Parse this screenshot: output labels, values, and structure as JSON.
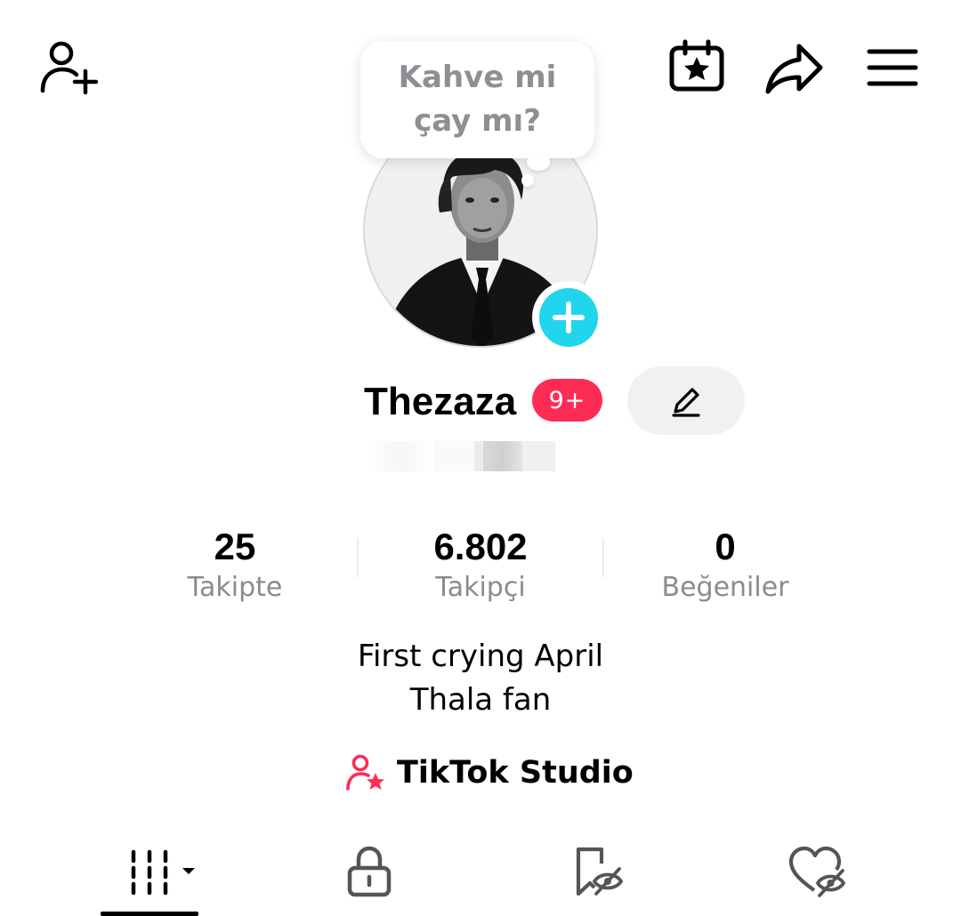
{
  "header": {
    "add_friend_icon": "person-plus-icon",
    "calendar_icon": "calendar-star-icon",
    "share_icon": "share-arrow-icon",
    "menu_icon": "hamburger-menu-icon"
  },
  "note": {
    "text": "Kahve mi\nçay mı?"
  },
  "profile": {
    "username": "Thezaza",
    "notification_badge": "9+",
    "edit_icon": "pencil-icon",
    "avatar_add_icon": "plus-icon"
  },
  "stats": [
    {
      "value": "25",
      "label": "Takipte"
    },
    {
      "value": "6.802",
      "label": "Takipçi"
    },
    {
      "value": "0",
      "label": "Beğeniler"
    }
  ],
  "bio": {
    "line1": "First crying April",
    "line2": "Thala fan"
  },
  "studio": {
    "label": "TikTok Studio",
    "icon": "creator-star-icon"
  },
  "tabs": [
    {
      "name": "videos-grid-tab",
      "icon": "grid-bars-icon",
      "active": true
    },
    {
      "name": "private-tab",
      "icon": "lock-icon",
      "active": false
    },
    {
      "name": "saved-hidden-tab",
      "icon": "bookmark-hidden-icon",
      "active": false
    },
    {
      "name": "liked-hidden-tab",
      "icon": "heart-hidden-icon",
      "active": false
    }
  ],
  "colors": {
    "accent_red": "#fe2c55",
    "accent_cyan": "#20d5ec",
    "muted_text": "#8a8b91"
  }
}
